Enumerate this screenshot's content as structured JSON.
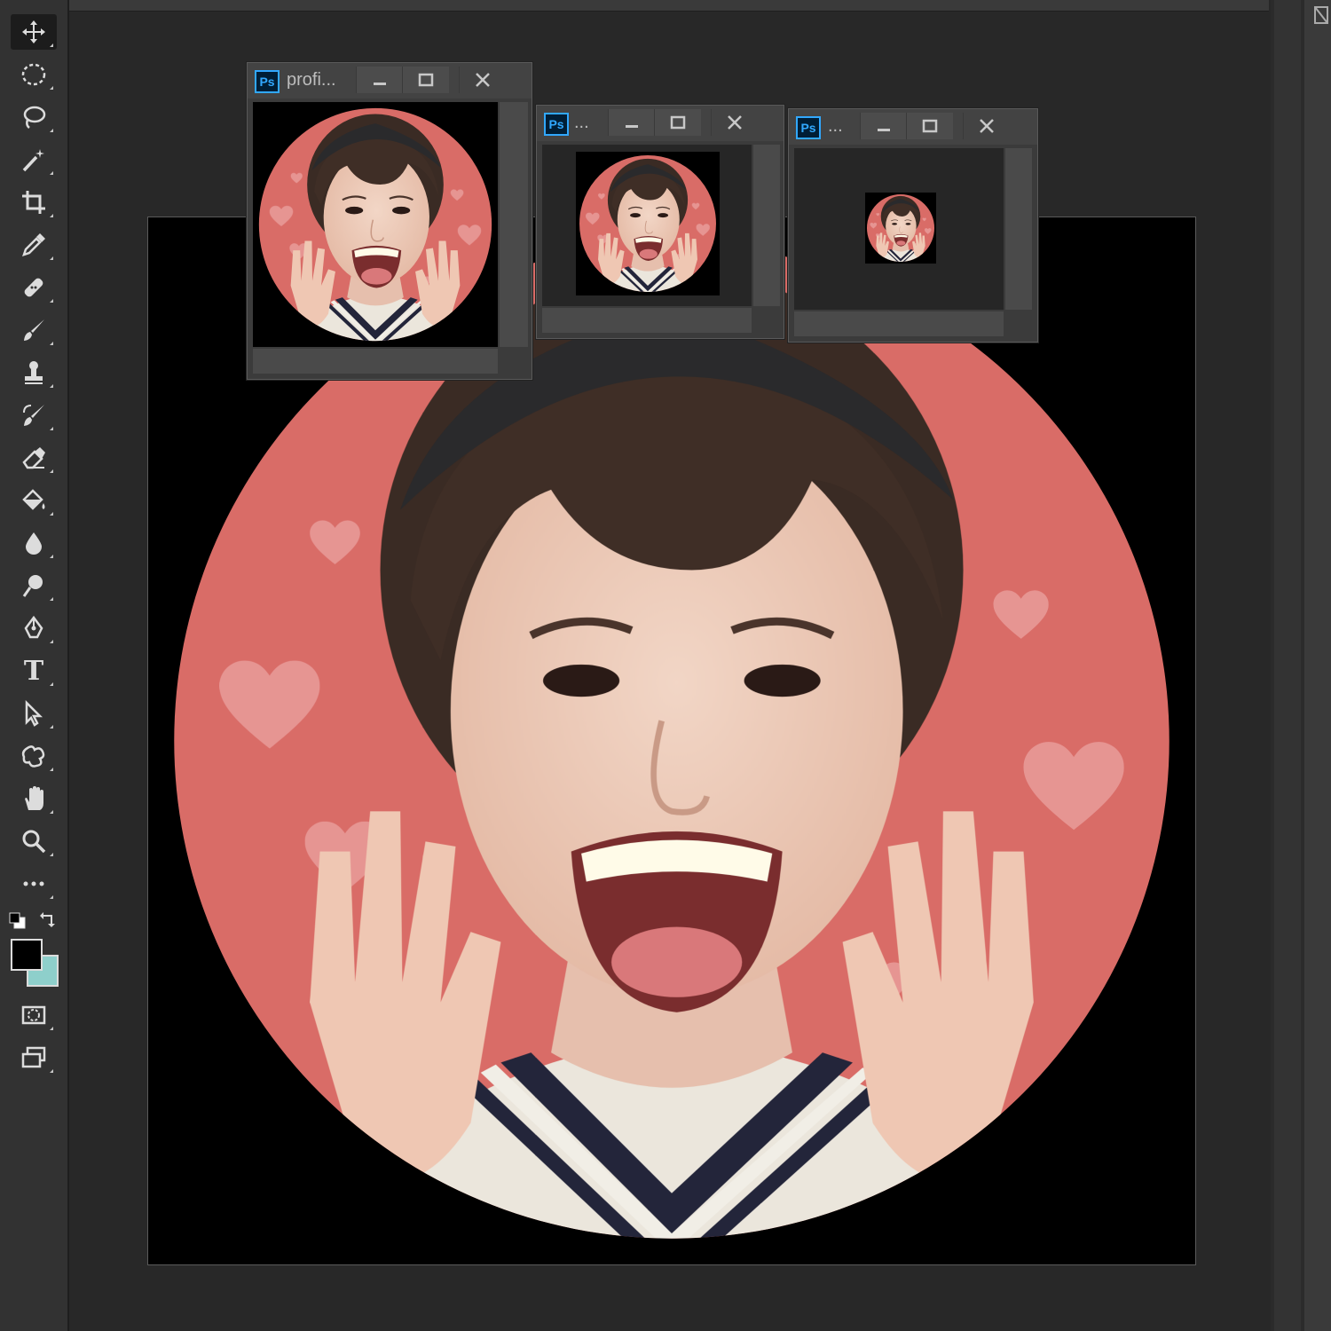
{
  "app": {
    "accent_colors": {
      "ps_blue": "#31a8ff",
      "background_pink": "#d96c67",
      "heart_pink": "#e89a98",
      "foreground_color": "#000000",
      "background_color": "#8ecfcb"
    }
  },
  "toolbar": {
    "tools": [
      {
        "icon": "move-tool-icon"
      },
      {
        "icon": "elliptical-marquee-icon"
      },
      {
        "icon": "lasso-icon"
      },
      {
        "icon": "magic-wand-icon"
      },
      {
        "icon": "crop-icon"
      },
      {
        "icon": "eyedropper-icon"
      },
      {
        "icon": "healing-brush-icon"
      },
      {
        "icon": "brush-icon"
      },
      {
        "icon": "clone-stamp-icon"
      },
      {
        "icon": "history-brush-icon"
      },
      {
        "icon": "eraser-icon"
      },
      {
        "icon": "paint-bucket-icon"
      },
      {
        "icon": "blur-icon"
      },
      {
        "icon": "dodge-icon"
      },
      {
        "icon": "pen-icon"
      },
      {
        "icon": "type-icon",
        "glyph": "T"
      },
      {
        "icon": "path-selection-icon"
      },
      {
        "icon": "custom-shape-icon"
      },
      {
        "icon": "hand-icon"
      },
      {
        "icon": "zoom-icon"
      },
      {
        "icon": "more-tools-icon"
      }
    ],
    "swatches": {
      "foreground": "#000000",
      "background": "#8ecfcb"
    }
  },
  "windows": [
    {
      "ps_label": "Ps",
      "title": "profi..."
    },
    {
      "ps_label": "Ps",
      "title": "..."
    },
    {
      "ps_label": "Ps",
      "title": "..."
    }
  ]
}
